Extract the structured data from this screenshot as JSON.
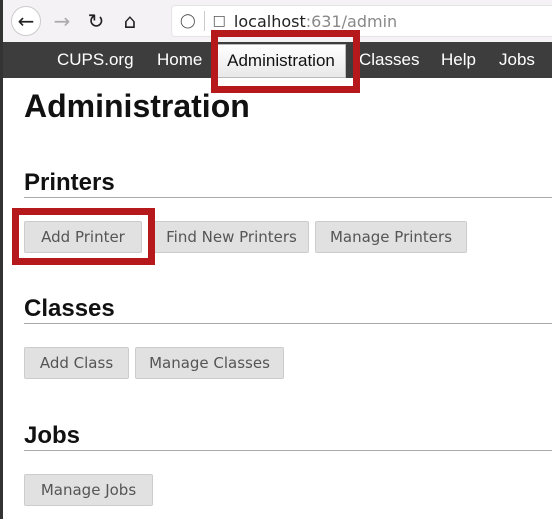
{
  "browser": {
    "url_host": "localhost",
    "url_rest": ":631/admin",
    "icons": [
      "back-icon",
      "forward-icon",
      "reload-icon",
      "home-icon",
      "shield-icon",
      "page-icon"
    ]
  },
  "nav": {
    "items": [
      "CUPS.org",
      "Home",
      "Administration",
      "Classes",
      "Help",
      "Jobs"
    ],
    "active": "Administration"
  },
  "page_title": "Administration",
  "sections": {
    "printers": {
      "title": "Printers",
      "buttons": [
        "Add Printer",
        "Find New Printers",
        "Manage Printers"
      ]
    },
    "classes": {
      "title": "Classes",
      "buttons": [
        "Add Class",
        "Manage Classes"
      ]
    },
    "jobs": {
      "title": "Jobs",
      "buttons": [
        "Manage Jobs"
      ]
    }
  },
  "colors": {
    "highlight": "#b5191c",
    "nav_bg": "#3d3d3d",
    "button_bg": "#e1e1e1"
  }
}
